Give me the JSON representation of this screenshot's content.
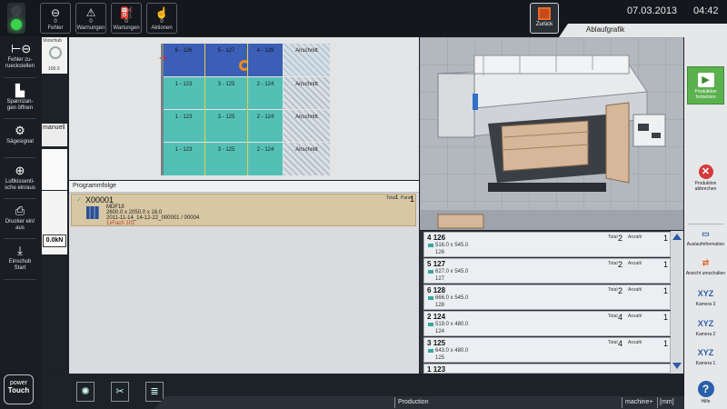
{
  "topbar": {
    "buttons": [
      {
        "count": "0",
        "label": "Fehler"
      },
      {
        "count": "0",
        "label": "Warnungen"
      },
      {
        "count": "0",
        "label": "Wartungen"
      },
      {
        "count": "0",
        "label": "Aktionen"
      }
    ],
    "back_label": "Zurück",
    "date": "07.03.2013",
    "time": "04:42",
    "tab_label": "Ablaufgrafik",
    "status_light": "green"
  },
  "sidebar": {
    "items": [
      {
        "label": "Fehler zu-\nrueckstellen",
        "icon": "reset-icon"
      },
      {
        "label": "Spannzan-\ngen öffnen",
        "icon": "clamp-icon"
      },
      {
        "label": "Sägesignal",
        "icon": "saw-icon"
      },
      {
        "label": "Luftkissenti-\nsche ein/aus",
        "icon": "aircushion-icon"
      },
      {
        "label": "Drucker ein/\naus",
        "icon": "printer-icon"
      },
      {
        "label": "Einschub\nStart",
        "icon": "infeed-icon"
      }
    ],
    "logo_top": "power",
    "logo_bottom": "Touch"
  },
  "status_column": {
    "vorschub_label": "Vorschub",
    "vorschub_value": "100.0",
    "mode": "manuell",
    "force_value": "0.0kN"
  },
  "grid": {
    "rows": [
      [
        "6 - 126",
        "5 - 127",
        "4 - 126",
        "Anschnitt"
      ],
      [
        "1 - 123",
        "3 - 125",
        "2 - 124",
        "Anschnitt"
      ],
      [
        "1 - 123",
        "3 - 125",
        "2 - 124",
        "Anschnitt"
      ],
      [
        "1 - 123",
        "3 - 125",
        "2 - 124",
        "Anschnitt"
      ]
    ]
  },
  "program": {
    "header": "Programmfolge",
    "item": {
      "id": "X00001",
      "material": "MDF18",
      "size": "2600.0 x 2050.0 x 16.0",
      "job": "2011-11-14_14-12-22_000001 / 00004",
      "note": "1xFach 101",
      "total_label": "Total",
      "total_value": "1",
      "panel_label": "Panel",
      "panel_value": "1"
    }
  },
  "parts": [
    {
      "num": "4",
      "code": "126",
      "dim": "516.0 x 545.0",
      "sub": "126",
      "total": "2",
      "anzahl": "1"
    },
    {
      "num": "5",
      "code": "127",
      "dim": "627.0 x 545.0",
      "sub": "127",
      "total": "2",
      "anzahl": "1"
    },
    {
      "num": "6",
      "code": "128",
      "dim": "666.0 x 545.0",
      "sub": "128",
      "total": "2",
      "anzahl": "1"
    },
    {
      "num": "2",
      "code": "124",
      "dim": "519.0 x 480.0",
      "sub": "124",
      "total": "4",
      "anzahl": "1"
    },
    {
      "num": "3",
      "code": "125",
      "dim": "643.0 x 480.0",
      "sub": "125",
      "total": "4",
      "anzahl": "1"
    },
    {
      "num": "1",
      "code": "123",
      "dim": "",
      "sub": "",
      "total": "",
      "anzahl": ""
    }
  ],
  "part_labels": {
    "total": "Total",
    "anzahl": "Anzahl"
  },
  "rightbar": {
    "continue_label": "Produktion fortsetzen",
    "abort_label": "Produktion abbrechen",
    "info_label": "Auslaufinformation",
    "switch_view_label": "Ansicht umschalten",
    "cam3_label": "Kamera 3",
    "cam2_label": "Kamera 2",
    "cam1_label": "Kamera 1",
    "help_label": "Hilfe"
  },
  "bottombar": {
    "production_label": "Production",
    "machine_label": "machine+",
    "unit_label": "[mm]"
  }
}
